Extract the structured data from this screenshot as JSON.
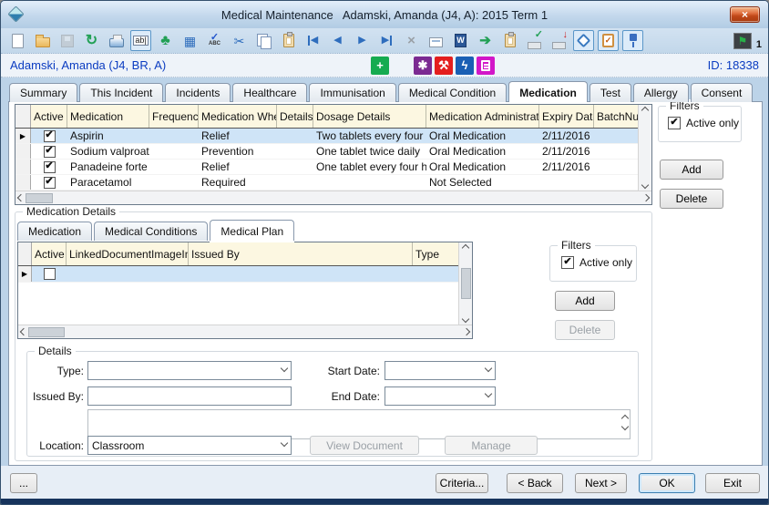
{
  "window": {
    "title": "Medical Maintenance   Adamski, Amanda (J4, A): 2015 Term 1",
    "close": "×"
  },
  "toolbar": {
    "find": "ab|",
    "refresh": "↻",
    "tree": "♣",
    "grid": "▦",
    "spell_check": "✓",
    "spell_abc": "ABC",
    "cut": "✂",
    "prev": "◀",
    "next": "▶",
    "delete": "×",
    "word": "W",
    "export": "➔",
    "check": "✓",
    "down": "↓",
    "flag": "⚑",
    "flag_count": "1",
    "icon_names": [
      "new-document",
      "open-folder",
      "save",
      "refresh",
      "print",
      "find",
      "tree",
      "grid",
      "spellcheck",
      "cut",
      "copy",
      "paste",
      "first-record",
      "previous-record",
      "next-record",
      "last-record",
      "delete-record",
      "memo",
      "word-document",
      "export",
      "clipboard",
      "approve",
      "import",
      "tag",
      "checklist",
      "pin",
      "flag"
    ]
  },
  "status": {
    "plus": "+",
    "star": "✱",
    "hammer": "⚒",
    "bolt": "ϟ"
  },
  "info": {
    "student": "Adamski, Amanda (J4, BR, A)",
    "id": "ID: 18338"
  },
  "tabs": [
    "Summary",
    "This Incident",
    "Incidents",
    "Healthcare",
    "Immunisation",
    "Medical Condition",
    "Medication",
    "Test",
    "Allergy",
    "Consent"
  ],
  "active_tab": "Medication",
  "filters": {
    "label": "Filters",
    "active_only": "Active only",
    "check": "✔",
    "add": "Add",
    "delete": "Delete"
  },
  "main_grid": {
    "marker": "▶",
    "columns": [
      "Active",
      "Medication",
      "Frequency",
      "Medication When",
      "Details",
      "Dosage Details",
      "Medication Administration",
      "Expiry Date",
      "BatchNum"
    ],
    "rows": [
      {
        "check": "✔",
        "medication": "Aspirin",
        "frequency": "",
        "when": "Relief",
        "details": "",
        "dosage": "Two tablets every four ho",
        "admin": "Oral Medication",
        "expiry": "2/11/2016",
        "batch": ""
      },
      {
        "check": "✔",
        "medication": "Sodium valproate",
        "frequency": "",
        "when": "Prevention",
        "details": "",
        "dosage": "One tablet twice daily",
        "admin": "Oral Medication",
        "expiry": "2/11/2016",
        "batch": ""
      },
      {
        "check": "✔",
        "medication": "Panadeine forte",
        "frequency": "",
        "when": "Relief",
        "details": "",
        "dosage": "One tablet every four hou",
        "admin": "Oral Medication",
        "expiry": "2/11/2016",
        "batch": ""
      },
      {
        "check": "✔",
        "medication": "Paracetamol",
        "frequency": "",
        "when": "Required",
        "details": "",
        "dosage": "",
        "admin": "Not Selected",
        "expiry": "",
        "batch": ""
      }
    ]
  },
  "med": {
    "label": "Medication Details",
    "tabs": [
      "Medication",
      "Medical Conditions",
      "Medical Plan"
    ],
    "active_tab": "Medical Plan",
    "marker": "▶",
    "columns": [
      "Active",
      "LinkedDocumentImageIndex",
      "Issued By",
      "Type"
    ],
    "filters": {
      "label": "Filters",
      "active_only": "Active only",
      "check": "✔",
      "add": "Add",
      "delete": "Delete"
    },
    "details": {
      "label": "Details",
      "type_label": "Type:",
      "start_label": "Start Date:",
      "issued_label": "Issued By:",
      "end_label": "End Date:",
      "location_label": "Location:",
      "location_value": "Classroom",
      "view_doc": "View Document",
      "manage": "Manage"
    }
  },
  "footer": {
    "more": "...",
    "criteria": "Criteria...",
    "back": "< Back",
    "next": "Next >",
    "ok": "OK",
    "exit": "Exit"
  }
}
